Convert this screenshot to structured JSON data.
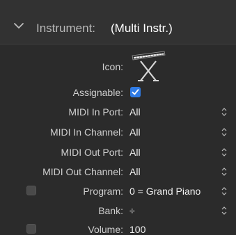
{
  "header": {
    "label": "Instrument:",
    "value": "(Multi Instr.)"
  },
  "icon_row": {
    "label": "Icon:",
    "icon": "keyboard-instrument-icon"
  },
  "fields": [
    {
      "label": "Assignable:",
      "value": "",
      "checked": true
    },
    {
      "label": "MIDI In Port:",
      "value": "All"
    },
    {
      "label": "MIDI In Channel:",
      "value": "All"
    },
    {
      "label": "MIDI Out Port:",
      "value": "All"
    },
    {
      "label": "MIDI Out Channel:",
      "value": "All"
    },
    {
      "label": "Program:",
      "value": "0 = Grand Piano",
      "enabled": false
    },
    {
      "label": "Bank:",
      "value": "÷"
    },
    {
      "label": "Volume:",
      "value": "100",
      "enabled": false
    }
  ],
  "colors": {
    "accent": "#2f7be5",
    "background": "#2b2b2b"
  }
}
